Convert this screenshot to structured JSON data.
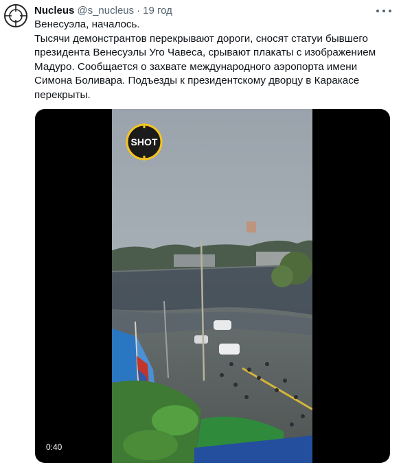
{
  "tweet": {
    "author_name": "Nucleus",
    "author_handle": "@s_nucleus",
    "separator": "·",
    "time": "19 год",
    "text_lines": [
      "Венесуэла, началось.",
      "Тысячи демонстрантов перекрывают дороги, сносят статуи бывшего президента Венесуэлы Уго Чавеса, срывают плакаты с изображением Мадуро. Сообщается о захвате международного аэропорта имени Симона Боливара. Подъезды к президентскому дворцу в Каракасе перекрыты."
    ]
  },
  "media": {
    "logo_text": "SHOT",
    "duration": "0:40"
  },
  "colors": {
    "secondary_text": "#536471",
    "logo_yellow": "#f7c51e"
  }
}
